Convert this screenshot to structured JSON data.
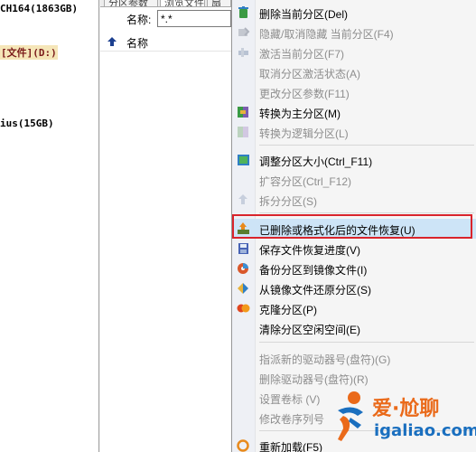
{
  "disk_tree": {
    "disk1_label": "CH164(1863GB)",
    "partition_d_label": "[文件](D:)",
    "disk2_label": "ius(15GB)"
  },
  "browse": {
    "tabs": [
      "分区参数",
      "浏览文件",
      "扇"
    ],
    "name_filter_label": "名称:",
    "name_filter_value": "*.*",
    "column_name": "名称"
  },
  "menu": {
    "items": [
      {
        "label": "删除当前分区(Del)",
        "enabled": true,
        "icon": "recycle-bin-icon"
      },
      {
        "label": "隐藏/取消隐藏 当前分区(F4)",
        "enabled": false,
        "icon": "hide-icon"
      },
      {
        "label": "激活当前分区(F7)",
        "enabled": false,
        "icon": "activate-icon"
      },
      {
        "label": "取消分区激活状态(A)",
        "enabled": false,
        "icon": ""
      },
      {
        "label": "更改分区参数(F11)",
        "enabled": false,
        "icon": ""
      },
      {
        "label": "转换为主分区(M)",
        "enabled": true,
        "icon": "convert-primary-icon"
      },
      {
        "label": "转换为逻辑分区(L)",
        "enabled": false,
        "icon": "convert-logical-icon"
      },
      {
        "label": "调整分区大小(Ctrl_F11)",
        "enabled": true,
        "icon": "resize-icon"
      },
      {
        "label": "扩容分区(Ctrl_F12)",
        "enabled": false,
        "icon": ""
      },
      {
        "label": "拆分分区(S)",
        "enabled": false,
        "icon": "split-icon"
      },
      {
        "label": "已删除或格式化后的文件恢复(U)",
        "enabled": true,
        "icon": "recover-icon"
      },
      {
        "label": "保存文件恢复进度(V)",
        "enabled": true,
        "icon": "save-icon"
      },
      {
        "label": "备份分区到镜像文件(I)",
        "enabled": true,
        "icon": "backup-icon"
      },
      {
        "label": "从镜像文件还原分区(S)",
        "enabled": true,
        "icon": "restore-icon"
      },
      {
        "label": "克隆分区(P)",
        "enabled": true,
        "icon": "clone-icon"
      },
      {
        "label": "清除分区空闲空间(E)",
        "enabled": true,
        "icon": ""
      },
      {
        "label": "指派新的驱动器号(盘符)(G)",
        "enabled": false,
        "icon": ""
      },
      {
        "label": "删除驱动器号(盘符)(R)",
        "enabled": false,
        "icon": ""
      },
      {
        "label": "设置卷标 (V)",
        "enabled": false,
        "icon": ""
      },
      {
        "label": "修改卷序列号",
        "enabled": false,
        "icon": ""
      },
      {
        "label": "重新加载(F5)",
        "enabled": true,
        "icon": "reload-icon"
      }
    ]
  },
  "colors": {
    "highlight_border": "#d9242c",
    "watermark_orange": "#ea6a1a",
    "watermark_blue": "#1a6fbf"
  },
  "watermark": {
    "cn_text": "爱·尬聊",
    "url_text": "igaliao.com"
  }
}
